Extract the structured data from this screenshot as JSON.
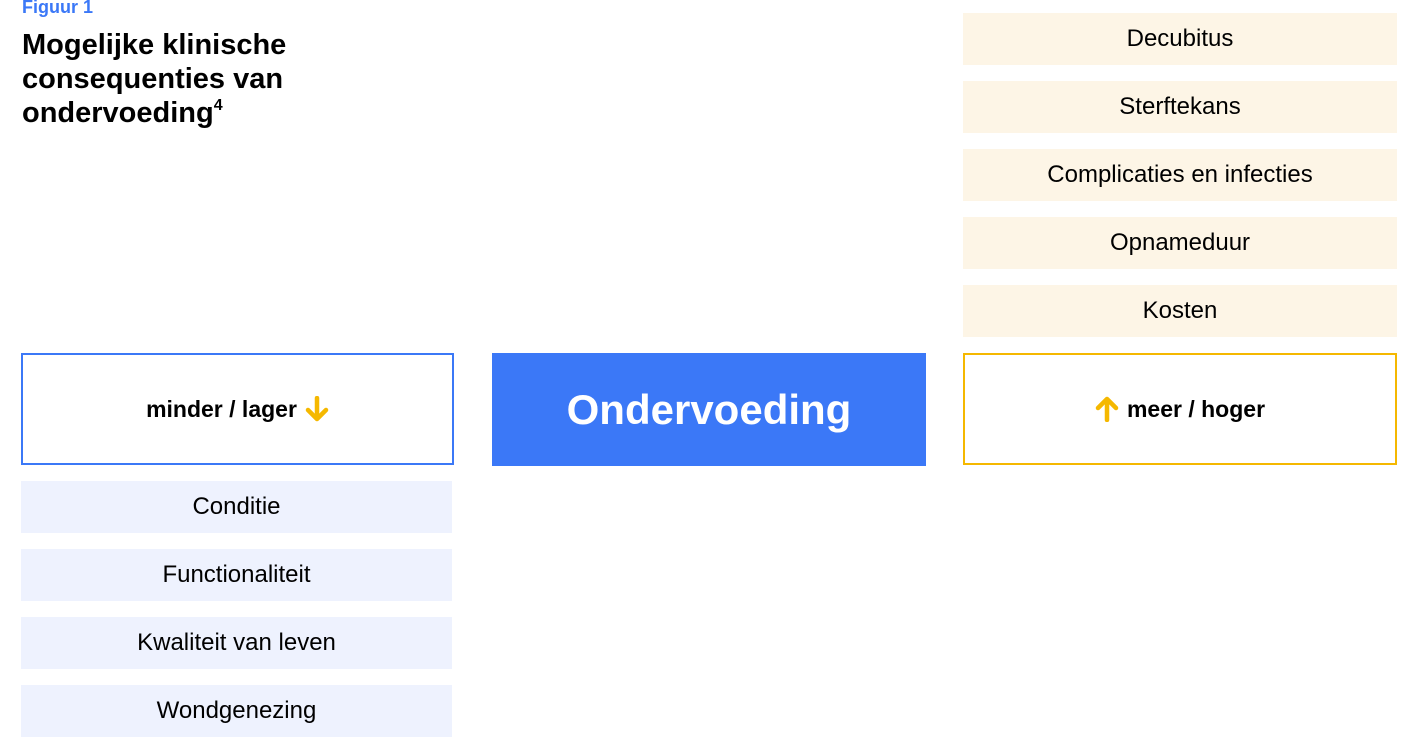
{
  "figure": {
    "label": "Figuur 1",
    "title": "Mogelijke klinische consequenties van ondervoeding",
    "title_superscript": "4"
  },
  "center": {
    "label": "Ondervoeding"
  },
  "left": {
    "header": "minder / lager",
    "items": [
      "Conditie",
      "Functionaliteit",
      "Kwaliteit van leven",
      "Wondgenezing"
    ]
  },
  "right": {
    "header": "meer / hoger",
    "items": [
      "Decubitus",
      "Sterftekans",
      "Complicaties en infecties",
      "Opnameduur",
      "Kosten"
    ]
  },
  "icons": {
    "down_arrow": "arrow-down-icon",
    "up_arrow": "arrow-up-icon"
  },
  "colors": {
    "primary_blue": "#3b78f7",
    "accent_yellow": "#f5b800",
    "up_box_fill": "#fdf5e6",
    "down_box_fill": "#eef2fe"
  }
}
